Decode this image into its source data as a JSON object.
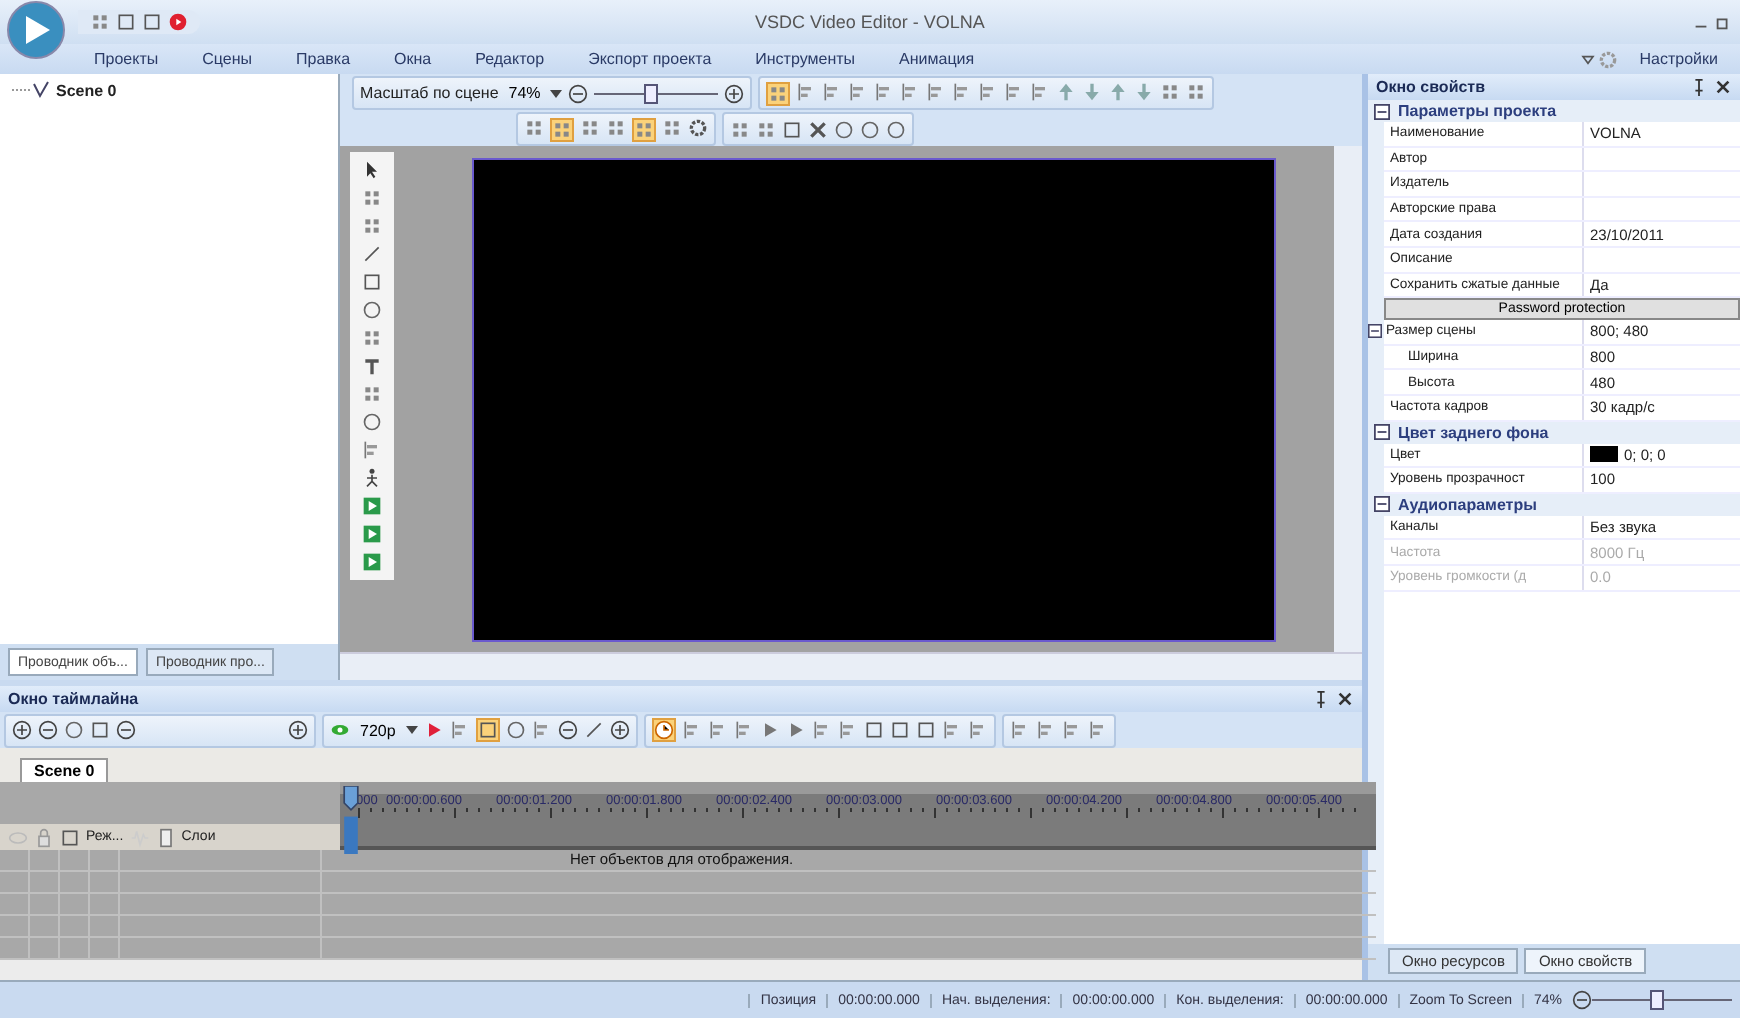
{
  "window": {
    "title": "VSDC Video Editor - VOLNA"
  },
  "menu": [
    {
      "label": "Проекты"
    },
    {
      "label": "Сцены"
    },
    {
      "label": "Правка"
    },
    {
      "label": "Окна"
    },
    {
      "label": "Редактор"
    },
    {
      "label": "Экспорт проекта"
    },
    {
      "label": "Инструменты"
    },
    {
      "label": "Анимация"
    }
  ],
  "settings": {
    "label": "Настройки"
  },
  "object_tree": {
    "items": [
      {
        "label": "Scene 0"
      }
    ]
  },
  "left_tabs": [
    {
      "label": "Проводник объ...",
      "selected": true
    },
    {
      "label": "Проводник про...",
      "selected": false
    }
  ],
  "scene_toolbar": {
    "zoom_label": "Масштаб по сцене",
    "zoom_value": "74%",
    "zoom_slider": {
      "level": 0.45
    }
  },
  "properties": {
    "title": "Окно свойств",
    "groups": [
      {
        "title": "Параметры проекта",
        "expanded": true,
        "rows": [
          {
            "kind": "row",
            "label": "Наименование",
            "value": "VOLNA"
          },
          {
            "kind": "row",
            "label": "Автор"
          },
          {
            "kind": "row",
            "label": "Издатель"
          },
          {
            "kind": "row",
            "label": "Авторские права"
          },
          {
            "kind": "row",
            "label": "Дата создания",
            "value": "23/10/2011"
          },
          {
            "kind": "row",
            "label": "Описание"
          },
          {
            "kind": "row",
            "label": "Сохранить сжатые данные",
            "value": "Да"
          },
          {
            "kind": "button",
            "label": "Password protection"
          },
          {
            "kind": "row",
            "label": "Размер сцены",
            "value": "800; 480",
            "expanded": true,
            "children": [
              {
                "label": "Ширина",
                "value": "800"
              },
              {
                "label": "Высота",
                "value": "480"
              }
            ]
          },
          {
            "kind": "row",
            "label": "Частота кадров",
            "value": "30 кадр/с"
          }
        ]
      },
      {
        "title": "Цвет заднего фона",
        "expanded": true,
        "rows": [
          {
            "kind": "row",
            "label": "Цвет",
            "value": "0; 0; 0",
            "color": "#000000"
          },
          {
            "kind": "row",
            "label": "Уровень прозрачност",
            "value": "100"
          }
        ]
      },
      {
        "title": "Аудиопараметры",
        "expanded": true,
        "rows": [
          {
            "kind": "row",
            "label": "Каналы",
            "value": "Без звука",
            "disabled": false
          },
          {
            "kind": "row",
            "label": "Частота",
            "value": "8000 Гц",
            "disabled": true
          },
          {
            "kind": "row",
            "label": "Уровень громкости (д",
            "value": "0.0",
            "disabled": true
          }
        ]
      }
    ]
  },
  "timeline": {
    "title": "Окно таймлайна",
    "resolution": "720p",
    "tabs": [
      {
        "label": "Scene 0",
        "selected": true
      }
    ],
    "ruler": [
      "000",
      "00:00:00.600",
      "00:00:01.200",
      "00:00:01.800",
      "00:00:02.400",
      "00:00:03.000",
      "00:00:03.600",
      "00:00:04.200",
      "00:00:04.800",
      "00:00:05.400"
    ],
    "track_header": {
      "mode": "Реж...",
      "layers": "Слои"
    },
    "empty_message": "Нет объектов для отображения."
  },
  "right_tabs": [
    {
      "label": "Окно ресурсов",
      "selected": false
    },
    {
      "label": "Окно свойств",
      "selected": true
    }
  ],
  "status_bar": {
    "fields": [
      {
        "label": "Позиция",
        "value": "00:00:00.000"
      },
      {
        "label": "Нач. выделения:",
        "value": "00:00:00.000"
      },
      {
        "label": "Кон. выделения:",
        "value": "00:00:00.000"
      }
    ],
    "zoom_label": "Zoom To Screen",
    "zoom_value": "74%",
    "zoom_slider": {
      "level": 0.45
    }
  }
}
